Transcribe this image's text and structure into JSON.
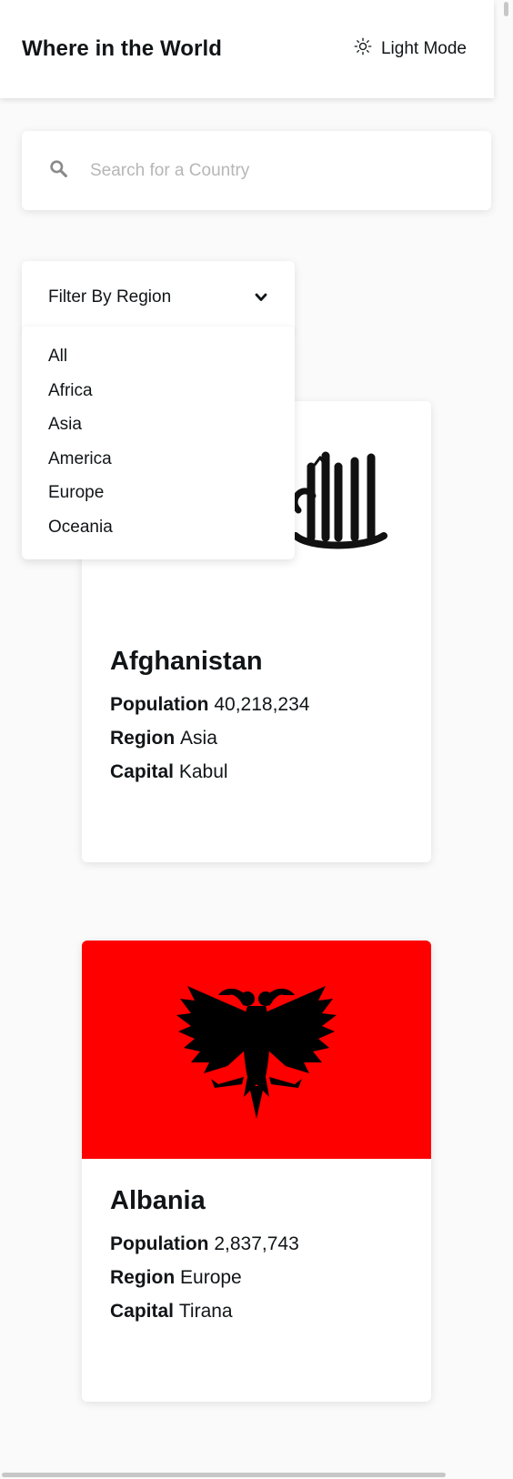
{
  "header": {
    "title": "Where in the World",
    "theme_toggle_label": "Light Mode",
    "theme_icon": "sun-icon"
  },
  "search": {
    "placeholder": "Search for a Country",
    "value": "",
    "icon": "search-icon"
  },
  "filter": {
    "label": "Filter By Region",
    "icon": "chevron-down-icon",
    "options": [
      "All",
      "Africa",
      "Asia",
      "America",
      "Europe",
      "Oceania"
    ]
  },
  "countries": [
    {
      "name": "Afghanistan",
      "population_label": "Population",
      "population": "40,218,234",
      "region_label": "Region",
      "region": "Asia",
      "capital_label": "Capital",
      "capital": "Kabul",
      "flag_color": "#ffffff"
    },
    {
      "name": "Albania",
      "population_label": "Population",
      "population": "2,837,743",
      "region_label": "Region",
      "region": "Europe",
      "capital_label": "Capital",
      "capital": "Tirana",
      "flag_color": "#fe0000"
    }
  ],
  "colors": {
    "background": "#fafafa",
    "surface": "#ffffff",
    "text": "#111517",
    "placeholder": "#b6b6b6"
  }
}
